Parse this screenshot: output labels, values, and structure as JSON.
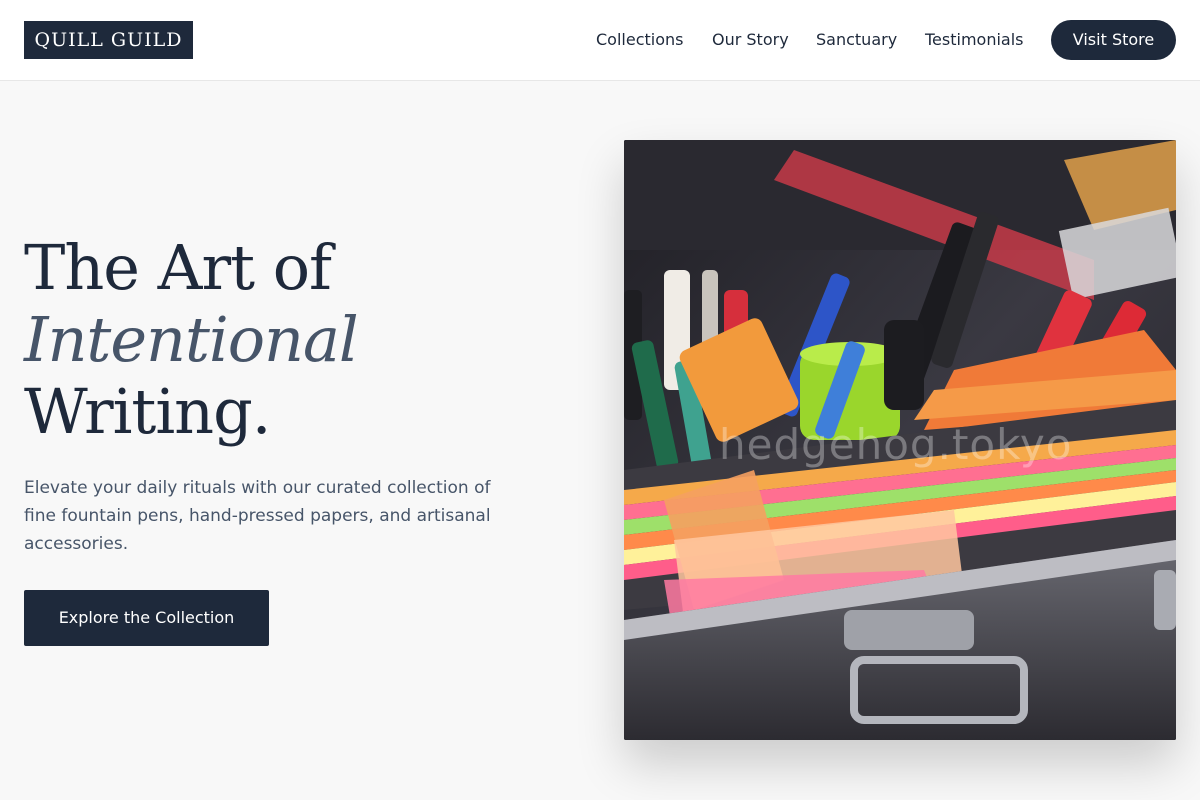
{
  "brand": {
    "logo_text": "QUILL GUILD"
  },
  "nav": {
    "items": [
      "Collections",
      "Our Story",
      "Sanctuary",
      "Testimonials"
    ],
    "cta_label": "Visit Store"
  },
  "hero": {
    "title_line1": "The Art of",
    "title_line2": "Intentional",
    "title_line3": "Writing.",
    "description": "Elevate your daily rituals with our curated collection of fine fountain pens, hand-pressed papers, and artisanal accessories.",
    "cta_label": "Explore the Collection",
    "image_watermark": "hedgehog.tokyo",
    "image_icon": "stationery-photo"
  },
  "colors": {
    "primary": "#1e293b",
    "accent_italic": "#475569",
    "background": "#f8f8f8",
    "header_bg": "#ffffff"
  }
}
